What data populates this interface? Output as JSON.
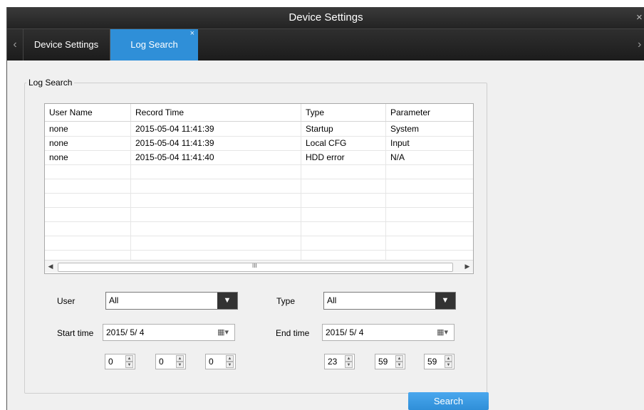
{
  "window": {
    "title": "Device Settings",
    "close_glyph": "×"
  },
  "tabs": {
    "nav_left": "‹",
    "nav_right": "›",
    "items": [
      {
        "label": "Device Settings"
      },
      {
        "label": "Log Search",
        "close_glyph": "×"
      }
    ]
  },
  "log_search": {
    "group_label": "Log Search",
    "columns": [
      "User Name",
      "Record Time",
      "Type",
      "Parameter"
    ],
    "rows": [
      [
        "none",
        "2015-05-04  11:41:39",
        "Startup",
        "System"
      ],
      [
        "none",
        "2015-05-04  11:41:39",
        "Local CFG",
        "Input"
      ],
      [
        "none",
        "2015-05-04  11:41:40",
        "HDD error",
        "N/A"
      ]
    ],
    "scroll_grip": "III"
  },
  "filters": {
    "user_label": "User",
    "user_value": "All",
    "type_label": "Type",
    "type_value": "All",
    "start_label": "Start time",
    "start_date": "2015/  5/  4",
    "end_label": "End time",
    "end_date": "2015/  5/  4",
    "start_hour": "0",
    "start_minute": "0",
    "start_second": "0",
    "end_hour": "23",
    "end_minute": "59",
    "end_second": "59"
  },
  "search_button": "Search"
}
